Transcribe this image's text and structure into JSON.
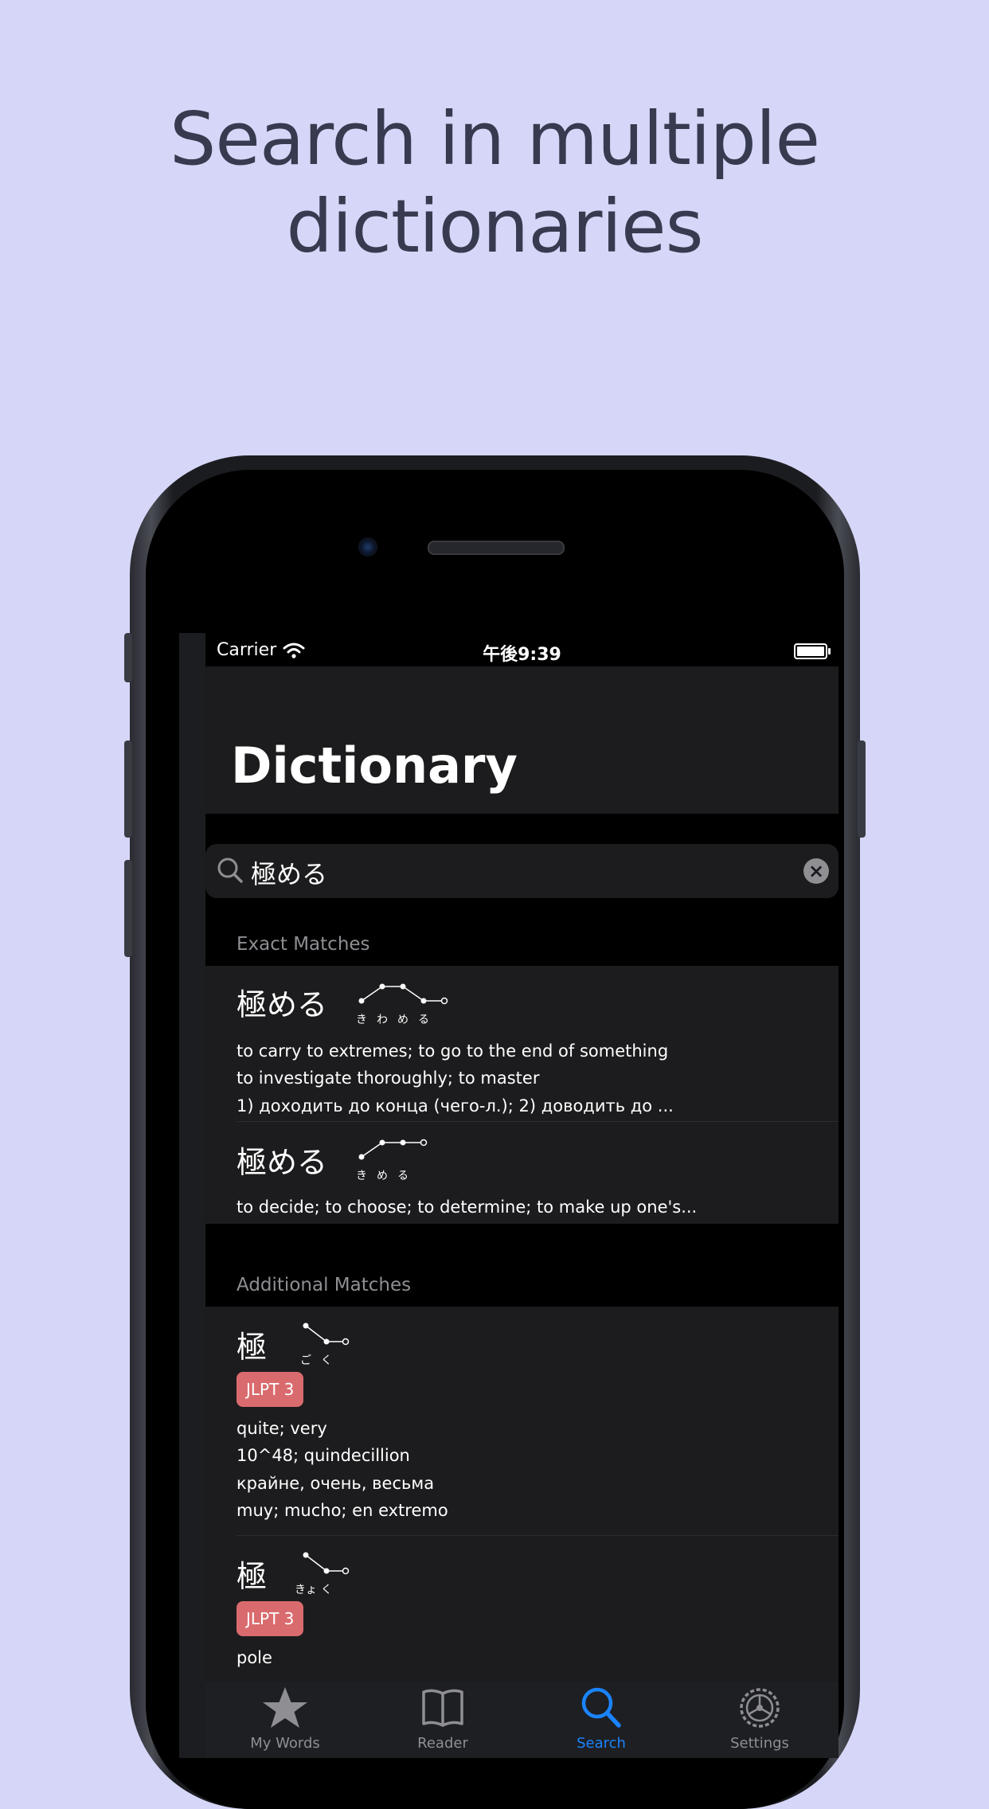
{
  "headline": {
    "line1": "Search in multiple",
    "line2": "dictionaries"
  },
  "status_bar": {
    "carrier": "Carrier",
    "time": "午後9:39"
  },
  "nav": {
    "title": "Dictionary"
  },
  "search": {
    "value": "極める"
  },
  "sections": {
    "exact": "Exact Matches",
    "additional": "Additional Matches"
  },
  "exact_matches": [
    {
      "word": "極める",
      "reading": [
        "き",
        "わ",
        "め",
        "る"
      ],
      "definitions": [
        "to carry to extremes; to go to the end of something",
        "to investigate thoroughly; to master",
        "1) доходить до конца (чего-л.); 2) доводить до ..."
      ]
    },
    {
      "word": "極める",
      "reading": [
        "き",
        "め",
        "る"
      ],
      "definitions": [
        "to decide; to choose; to determine; to make up one's..."
      ]
    }
  ],
  "additional_matches": [
    {
      "word": "極",
      "reading": [
        "ご",
        "く"
      ],
      "badge": "JLPT 3",
      "definitions": [
        "quite; very",
        "10^48; quindecillion",
        "крайне, очень, весьма",
        "muy; mucho; en extremo"
      ]
    },
    {
      "word": "極",
      "reading": [
        "きょ",
        "く"
      ],
      "badge": "JLPT 3",
      "definitions": [
        "pole"
      ]
    }
  ],
  "tabs": [
    {
      "label": "My Words",
      "icon": "star-icon"
    },
    {
      "label": "Reader",
      "icon": "book-icon"
    },
    {
      "label": "Search",
      "icon": "magnifier-icon",
      "active": true
    },
    {
      "label": "Settings",
      "icon": "gear-icon"
    }
  ],
  "colors": {
    "background": "#d6d7f8",
    "headline": "#363b4f",
    "accent": "#1a84ff",
    "jlpt_badge": "#d96b6e",
    "row_bg": "#1c1c1e"
  }
}
